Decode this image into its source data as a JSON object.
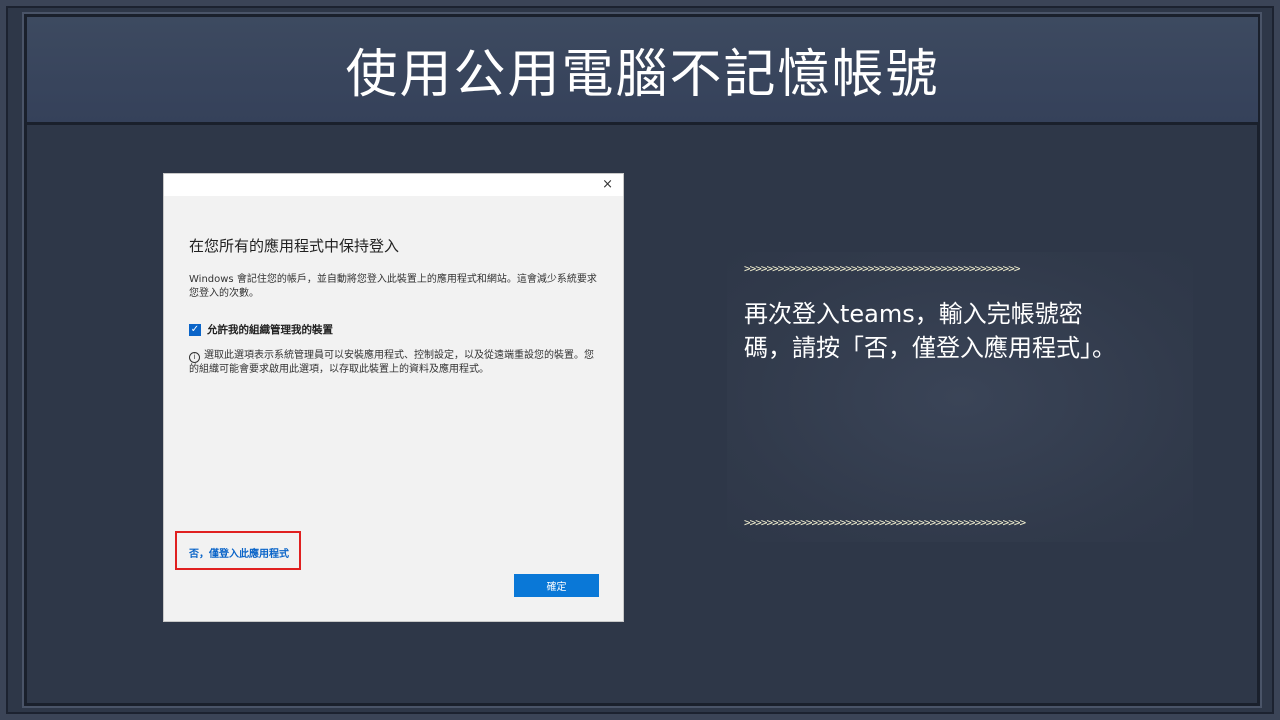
{
  "slide": {
    "title": "使用公用電腦不記憶帳號"
  },
  "dialog": {
    "close_glyph": "×",
    "heading": "在您所有的應用程式中保持登入",
    "description": "Windows 會記住您的帳戶，並自動將您登入此裝置上的應用程式和網站。這會減少系統要求您登入的次數。",
    "checkbox": {
      "checked": true,
      "label": "允許我的組織管理我的裝置"
    },
    "info_text": "選取此選項表示系統管理員可以安裝應用程式、控制設定，以及從遠端重設您的裝置。您的組織可能會要求啟用此選項，以存取此裝置上的資料及應用程式。",
    "no_link": "否，僅登入此應用程式",
    "ok_button": "確定"
  },
  "note": {
    "arrows_top": ">>>>>>>>>>>>>>>>>>>>>>>>>>>>>>>>>>>>>>>>>>>>>>>>>",
    "text": "再次登入teams，輸入完帳號密碼，請按「否，僅登入應用程式」。",
    "arrows_bottom": ">>>>>>>>>>>>>>>>>>>>>>>>>>>>>>>>>>>>>>>>>>>>>>>>>>"
  },
  "colors": {
    "background": "#2e3748",
    "title_bar": "#3d4a60",
    "accent_blue": "#0a78d7",
    "highlight_red": "#e02020",
    "arrow_color": "#f4f1d2"
  }
}
